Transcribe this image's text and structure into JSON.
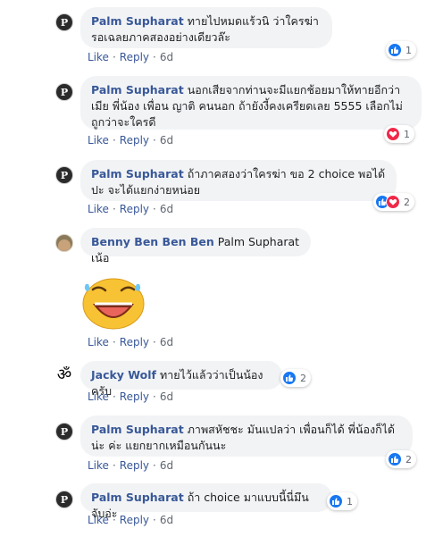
{
  "comments": [
    {
      "author": "Palm Supharat",
      "text": "ทายไปหมดแร้วนิ ว่าใครฆ่า รอเฉลยภาคสองอย่างเดียวล๊ะ",
      "like_label": "Like",
      "reply_label": "Reply",
      "time": "6d",
      "reaction_count": "1",
      "reactions": [
        "like"
      ]
    },
    {
      "author": "Palm Supharat",
      "text": "นอกเสียจากท่านจะมีแยกช้อยมาให้ทายอีกว่าเมีย พี่น้อง เพื่อน ญาติ คนนอก ถ้ายังงี้คงเครียดเลย 5555 เลือกไม่ถูกว่าจะใครดี",
      "like_label": "Like",
      "reply_label": "Reply",
      "time": "6d",
      "reaction_count": "1",
      "reactions": [
        "love"
      ]
    },
    {
      "author": "Palm Supharat",
      "text": "ถ้าภาคสองว่าใครฆ่า ขอ 2 choice พอได้ปะ จะได้แยกง่ายหน่อย",
      "like_label": "Like",
      "reply_label": "Reply",
      "time": "6d",
      "reaction_count": "2",
      "reactions": [
        "like",
        "love"
      ]
    },
    {
      "author": "Benny Ben Ben Ben",
      "text": "Palm Supharat เน้อ",
      "like_label": "Like",
      "reply_label": "Reply",
      "time": "6d",
      "sticker": "laughing-face-sticker"
    },
    {
      "author": "Jacky Wolf",
      "text": "ทายไว้แล้วว่าเป็นน้องครับ",
      "like_label": "Like",
      "reply_label": "Reply",
      "time": "6d",
      "reaction_count": "2",
      "reactions": [
        "like"
      ]
    },
    {
      "author": "Palm Supharat",
      "text": "ภาพสหัชชะ มันแปลว่า เพื่อนก็ได้ พี่น้องก็ได้น่ะ ค่ะ แยกยากเหมือนกันนะ",
      "like_label": "Like",
      "reply_label": "Reply",
      "time": "6d",
      "reaction_count": "2",
      "reactions": [
        "like"
      ]
    },
    {
      "author": "Palm Supharat",
      "text": "ถ้า choice มาแบบนี้นี่มึนจับอ่ะ",
      "like_label": "Like",
      "reply_label": "Reply",
      "time": "6d",
      "reaction_count": "1",
      "reactions": [
        "like"
      ]
    }
  ],
  "icons": {
    "like": "thumbs-up-icon",
    "love": "heart-icon",
    "om": "om-symbol-icon"
  },
  "colors": {
    "name": "#385898",
    "bubble": "#f2f3f5",
    "like": "#1877f2",
    "love": "#f02849",
    "meta": "#606770"
  }
}
